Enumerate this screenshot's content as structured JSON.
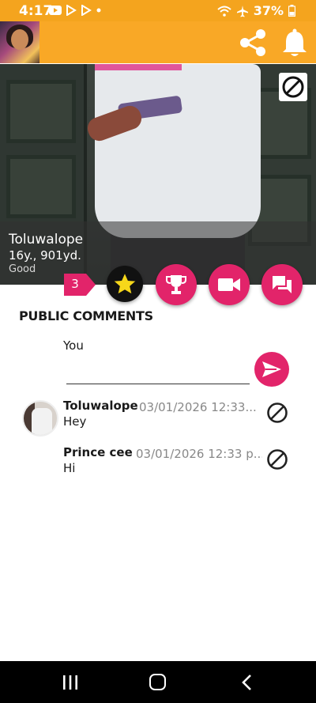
{
  "status_bar": {
    "time": "4:17",
    "battery": "37%",
    "left_icons": [
      "youtube-icon",
      "play-icon",
      "play-icon",
      "dot-icon"
    ],
    "right_icons": [
      "wifi-icon",
      "airplane-icon",
      "battery-icon"
    ]
  },
  "app_bar": {
    "background": "#f9a826",
    "icons": [
      "share-icon",
      "bell-icon"
    ]
  },
  "profile": {
    "name": "Toluwalope",
    "age_distance": "16y., 901yd.",
    "status": "Good"
  },
  "actions": {
    "count": "3",
    "accent": "#e2246a",
    "buttons": [
      "star-icon",
      "trophy-icon",
      "video-camera-icon",
      "chat-icon"
    ]
  },
  "comments": {
    "heading": "PUBLIC COMMENTS",
    "compose_label": "You",
    "input_value": "",
    "items": [
      {
        "author": "Toluwalope",
        "date": "03/01/2026 12:33...",
        "text": "Hey"
      },
      {
        "author": "Prince cee",
        "date": "03/01/2026 12:33 p...",
        "text": "Hi"
      }
    ]
  }
}
